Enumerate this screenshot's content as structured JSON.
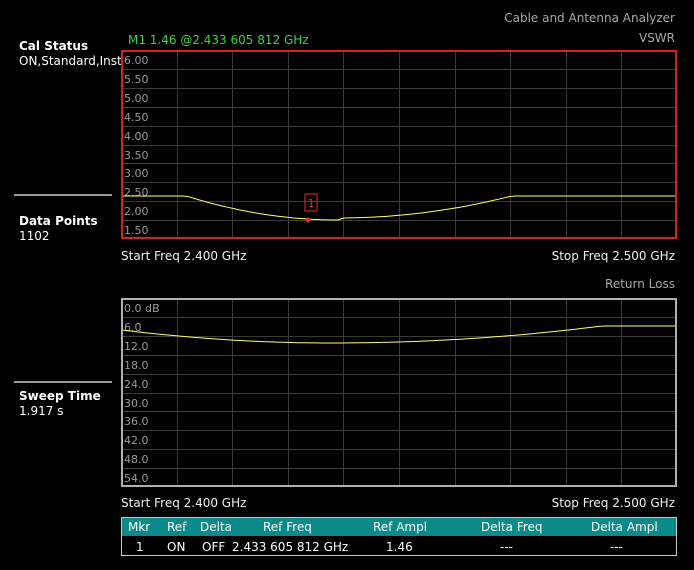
{
  "header": {
    "app_title": "Cable and Antenna Analyzer",
    "top_measurement": "VSWR",
    "bottom_measurement": "Return Loss",
    "marker_readout": "M1 1.46 @2.433 605 812 GHz"
  },
  "sidebar": {
    "cal_status": {
      "label": "Cal Status",
      "value": "ON,Standard,Insta"
    },
    "data_points": {
      "label": "Data Points",
      "value": "1102"
    },
    "sweep_time": {
      "label": "Sweep Time",
      "value": "1.917 s"
    }
  },
  "top_plot": {
    "start_freq": "Start Freq 2.400 GHz",
    "stop_freq": "Stop Freq 2.500 GHz",
    "y_ticks": [
      "6.00",
      "5.50",
      "5.00",
      "4.50",
      "4.00",
      "3.50",
      "3.00",
      "2.50",
      "2.00",
      "1.50"
    ],
    "marker_label": "1",
    "frame_color": "#d82020",
    "trace_color": "#ffff66"
  },
  "bottom_plot": {
    "start_freq": "Start Freq 2.400 GHz",
    "stop_freq": "Stop Freq 2.500 GHz",
    "y_ticks": [
      "0.0 dB",
      "6.0",
      "12.0",
      "18.0",
      "24.0",
      "30.0",
      "36.0",
      "42.0",
      "48.0",
      "54.0"
    ],
    "frame_color": "#b0b0b0",
    "trace_color": "#ffff66"
  },
  "marker_table": {
    "headers": [
      "Mkr",
      "Ref",
      "Delta",
      "Ref Freq",
      "Ref Ampl",
      "Delta Freq",
      "Delta Ampl"
    ],
    "rows": [
      [
        "1",
        "ON",
        "OFF",
        "2.433 605 812 GHz",
        "1.46",
        "---",
        "---"
      ]
    ],
    "header_color": "#0b8a8a"
  }
}
